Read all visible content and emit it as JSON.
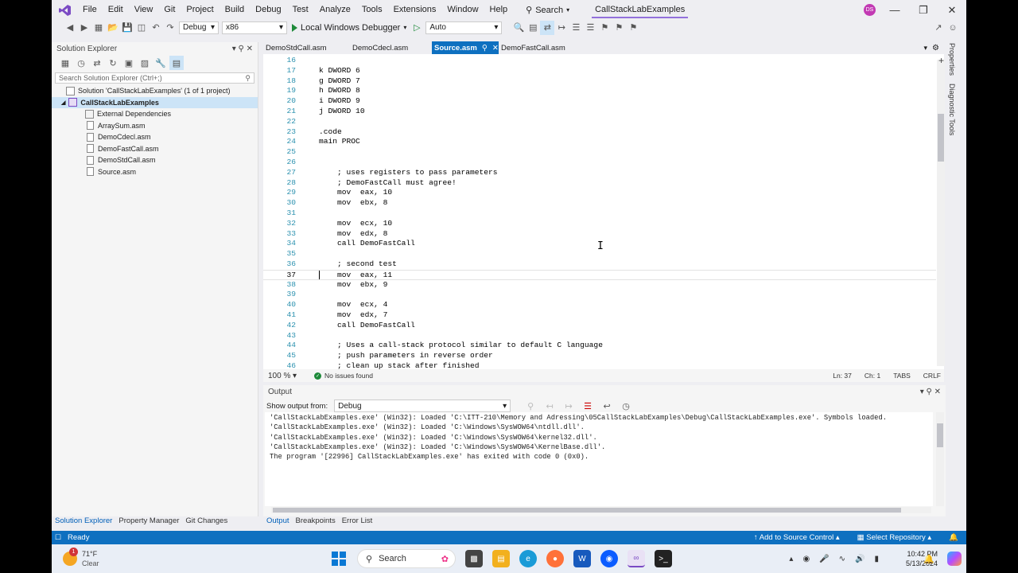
{
  "titlebar": {
    "menu": [
      "File",
      "Edit",
      "View",
      "Git",
      "Project",
      "Build",
      "Debug",
      "Test",
      "Analyze",
      "Tools",
      "Extensions",
      "Window",
      "Help"
    ],
    "search_label": "Search",
    "solution_name": "CallStackLabExamples",
    "avatar_initials": "DS"
  },
  "toolbar": {
    "config": "Debug",
    "platform": "x86",
    "run_label": "Local Windows Debugger",
    "auto": "Auto"
  },
  "solution_explorer": {
    "title": "Solution Explorer",
    "search_placeholder": "Search Solution Explorer (Ctrl+;)",
    "solution_label": "Solution 'CallStackLabExamples' (1 of 1 project)",
    "project": "CallStackLabExamples",
    "items": [
      "External Dependencies",
      "ArraySum.asm",
      "DemoCdecl.asm",
      "DemoFastCall.asm",
      "DemoStdCall.asm",
      "Source.asm"
    ]
  },
  "bottom_tabs_left": [
    "Solution Explorer",
    "Property Manager",
    "Git Changes"
  ],
  "doc_tabs": [
    "DemoStdCall.asm",
    "DemoCdecl.asm",
    "Source.asm",
    "DemoFastCall.asm"
  ],
  "editor": {
    "lines": [
      {
        "n": "16",
        "t": ""
      },
      {
        "n": "17",
        "t": "k DWORD 6"
      },
      {
        "n": "18",
        "t": "g DWORD 7"
      },
      {
        "n": "19",
        "t": "h DWORD 8"
      },
      {
        "n": "20",
        "t": "i DWORD 9"
      },
      {
        "n": "21",
        "t": "j DWORD 10"
      },
      {
        "n": "22",
        "t": ""
      },
      {
        "n": "23",
        "t": ".code"
      },
      {
        "n": "24",
        "t": "main PROC"
      },
      {
        "n": "25",
        "t": ""
      },
      {
        "n": "26",
        "t": ""
      },
      {
        "n": "27",
        "t": "    ; uses registers to pass parameters"
      },
      {
        "n": "28",
        "t": "    ; DemoFastCall must agree!"
      },
      {
        "n": "29",
        "t": "    mov  eax, 10"
      },
      {
        "n": "30",
        "t": "    mov  ebx, 8"
      },
      {
        "n": "31",
        "t": ""
      },
      {
        "n": "32",
        "t": "    mov  ecx, 10"
      },
      {
        "n": "33",
        "t": "    mov  edx, 8"
      },
      {
        "n": "34",
        "t": "    call DemoFastCall"
      },
      {
        "n": "35",
        "t": ""
      },
      {
        "n": "36",
        "t": "    ; second test"
      },
      {
        "n": "37",
        "t": "    mov  eax, 11"
      },
      {
        "n": "38",
        "t": "    mov  ebx, 9"
      },
      {
        "n": "39",
        "t": ""
      },
      {
        "n": "40",
        "t": "    mov  ecx, 4"
      },
      {
        "n": "41",
        "t": "    mov  edx, 7"
      },
      {
        "n": "42",
        "t": "    call DemoFastCall"
      },
      {
        "n": "43",
        "t": ""
      },
      {
        "n": "44",
        "t": "    ; Uses a call-stack protocol similar to default C language"
      },
      {
        "n": "45",
        "t": "    ; push parameters in reverse order"
      },
      {
        "n": "46",
        "t": "    ; clean up stack after finished"
      }
    ],
    "current_line": "37",
    "zoom": "100 %",
    "issues": "No issues found",
    "ln": "Ln: 37",
    "ch": "Ch: 1",
    "tabs": "TABS",
    "eol": "CRLF"
  },
  "output": {
    "title": "Output",
    "show_from_label": "Show output from:",
    "source": "Debug",
    "lines": [
      "'CallStackLabExamples.exe' (Win32): Loaded 'C:\\ITT-210\\Memory and Adressing\\05CallStackLabExamples\\Debug\\CallStackLabExamples.exe'. Symbols loaded.",
      "'CallStackLabExamples.exe' (Win32): Loaded 'C:\\Windows\\SysWOW64\\ntdll.dll'.",
      "'CallStackLabExamples.exe' (Win32): Loaded 'C:\\Windows\\SysWOW64\\kernel32.dll'.",
      "'CallStackLabExamples.exe' (Win32): Loaded 'C:\\Windows\\SysWOW64\\KernelBase.dll'.",
      "The program '[22996] CallStackLabExamples.exe' has exited with code 0 (0x0)."
    ],
    "tabs": [
      "Output",
      "Breakpoints",
      "Error List"
    ]
  },
  "side_tabs": [
    "Properties",
    "Diagnostic Tools"
  ],
  "status": {
    "ready": "Ready",
    "source_control": "Add to Source Control",
    "repo": "Select Repository"
  },
  "taskbar": {
    "temp": "71°F",
    "weather": "Clear",
    "badge": "1",
    "search": "Search",
    "time": "10:42 PM",
    "date": "5/13/2024"
  }
}
